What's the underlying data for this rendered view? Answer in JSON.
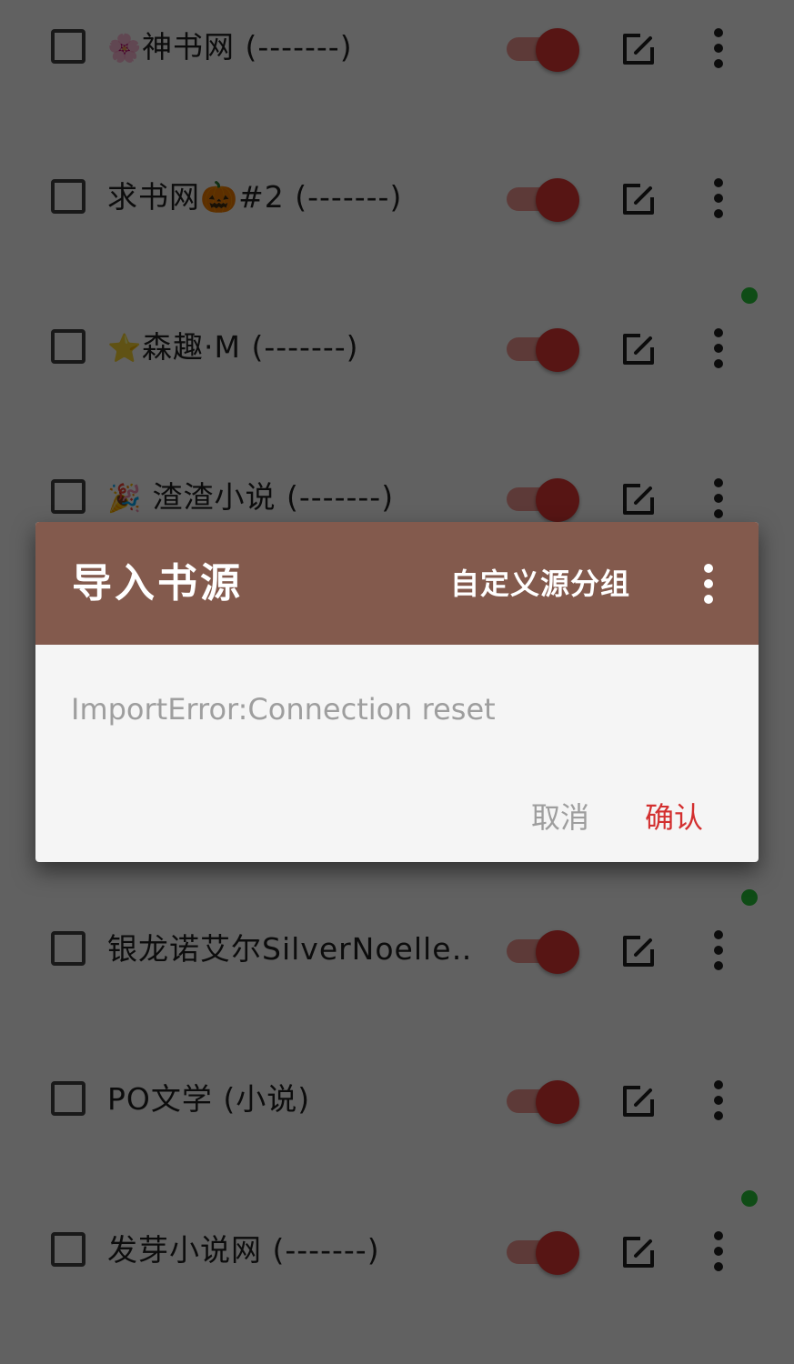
{
  "theme": {
    "accent": "#e53935",
    "switch_track": "#f39a94",
    "dialog_header": "#835a4d",
    "confirm_color": "#d32f2f",
    "status_dot": "#28c83a"
  },
  "source_list": {
    "items": [
      {
        "emoji": "🌸",
        "name": "神书网 (-------)",
        "enabled": true,
        "status_dot": false
      },
      {
        "emoji": "",
        "name": "求书网🎃#2 (-------)",
        "enabled": true,
        "status_dot": false
      },
      {
        "emoji": "⭐",
        "name": "森趣·M (-------)",
        "enabled": true,
        "status_dot": true
      },
      {
        "emoji": "🎉",
        "name": " 渣渣小说 (-------)",
        "enabled": true,
        "status_dot": false
      },
      {
        "emoji": "",
        "name": "银龙诺艾尔SilverNoelle…",
        "enabled": true,
        "status_dot": true
      },
      {
        "emoji": "",
        "name": "PO文学 (小说)",
        "enabled": true,
        "status_dot": false
      },
      {
        "emoji": "",
        "name": "发芽小说网 (-------)",
        "enabled": true,
        "status_dot": true
      }
    ]
  },
  "dialog": {
    "title": "导入书源",
    "group_button": "自定义源分组",
    "message": "ImportError:Connection reset",
    "cancel": "取消",
    "confirm": "确认"
  }
}
